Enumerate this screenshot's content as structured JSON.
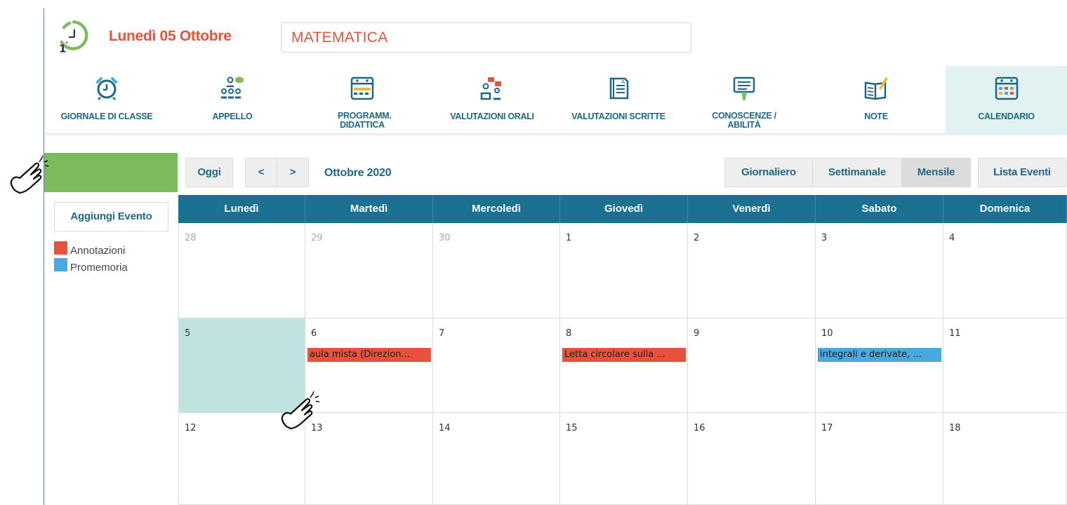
{
  "header": {
    "date": "Lunedì 05 Ottobre",
    "subject": "MATEMATICA",
    "clock_icon": "clock-hour-icon"
  },
  "toolbar": {
    "items": [
      {
        "label": "GIORNALE DI CLASSE",
        "icon": "alarm-clock-icon"
      },
      {
        "label": "APPELLO",
        "icon": "roll-call-icon"
      },
      {
        "label": "PROGRAMM. DIDATTICA",
        "icon": "planner-icon"
      },
      {
        "label": "VALUTAZIONI ORALI",
        "icon": "oral-grades-icon"
      },
      {
        "label": "VALUTAZIONI SCRITTE",
        "icon": "written-grades-icon"
      },
      {
        "label": "CONOSCENZE / ABILITÀ",
        "icon": "skills-board-icon"
      },
      {
        "label": "NOTE",
        "icon": "notebook-pencil-icon"
      },
      {
        "label": "CALENDARIO",
        "icon": "calendar-icon"
      }
    ]
  },
  "sidebar": {
    "add_event": "Aggiungi Evento",
    "legend": [
      {
        "label": "Annotazioni",
        "color": "#e8523d"
      },
      {
        "label": "Promemoria",
        "color": "#4aa8df"
      }
    ]
  },
  "calendar": {
    "today_btn": "Oggi",
    "prev_btn": "<",
    "next_btn": ">",
    "month_title": "Ottobre 2020",
    "views": [
      "Giornaliero",
      "Settimanale",
      "Mensile",
      "Lista Eventi"
    ],
    "active_view": "Mensile",
    "weekdays": [
      "Lunedì",
      "Martedì",
      "Mercoledì",
      "Giovedì",
      "Venerdì",
      "Sabato",
      "Domenica"
    ],
    "weeks": [
      [
        {
          "day": "28",
          "other": true
        },
        {
          "day": "29",
          "other": true
        },
        {
          "day": "30",
          "other": true
        },
        {
          "day": "1"
        },
        {
          "day": "2"
        },
        {
          "day": "3"
        },
        {
          "day": "4"
        }
      ],
      [
        {
          "day": "5",
          "today": true
        },
        {
          "day": "6",
          "event": {
            "text": "aula mista (Direzion...",
            "type": "annotazione"
          }
        },
        {
          "day": "7"
        },
        {
          "day": "8",
          "event": {
            "text": "Letta circolare sulla ...",
            "type": "annotazione"
          }
        },
        {
          "day": "9"
        },
        {
          "day": "10",
          "event": {
            "text": "integrali e derivate, ...",
            "type": "promemoria"
          }
        },
        {
          "day": "11"
        }
      ],
      [
        {
          "day": "12"
        },
        {
          "day": "13"
        },
        {
          "day": "14"
        },
        {
          "day": "15"
        },
        {
          "day": "16"
        },
        {
          "day": "17"
        },
        {
          "day": "18"
        }
      ]
    ]
  },
  "colors": {
    "accent": "#e8523d",
    "primary": "#1f6784",
    "header_bg": "#1a7191",
    "today_bg": "#bfe3e1",
    "green_bar": "#7cbb5c",
    "annotazione": "#e8523d",
    "promemoria": "#4aa8df"
  }
}
